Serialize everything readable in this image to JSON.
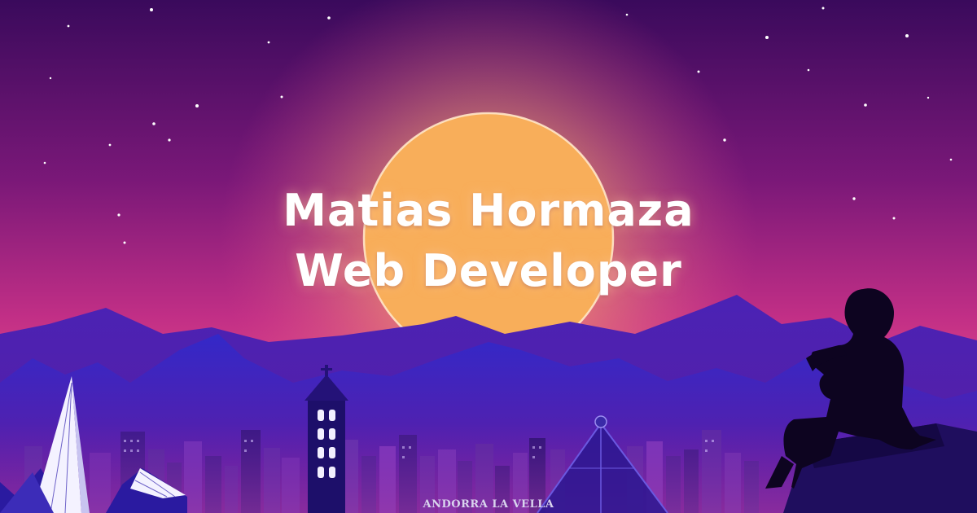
{
  "hero": {
    "name": "Matias Hormaza",
    "role": "Web Developer",
    "location_caption": "ANDORRA LA VELLA"
  },
  "colors": {
    "sky_top": "#3a0a5c",
    "sky_mid": "#a0237d",
    "sky_horizon": "#e04a8a",
    "sun": "#f6b058",
    "mountains_back": "#3b1fa8",
    "mountains_front": "#2a1288",
    "city_dark": "#1a0b5a",
    "silhouette": "#0d0420"
  },
  "icons": [
    "person-silhouette-icon",
    "church-tower-icon",
    "pyramid-building-icon",
    "church-spire-icon"
  ]
}
